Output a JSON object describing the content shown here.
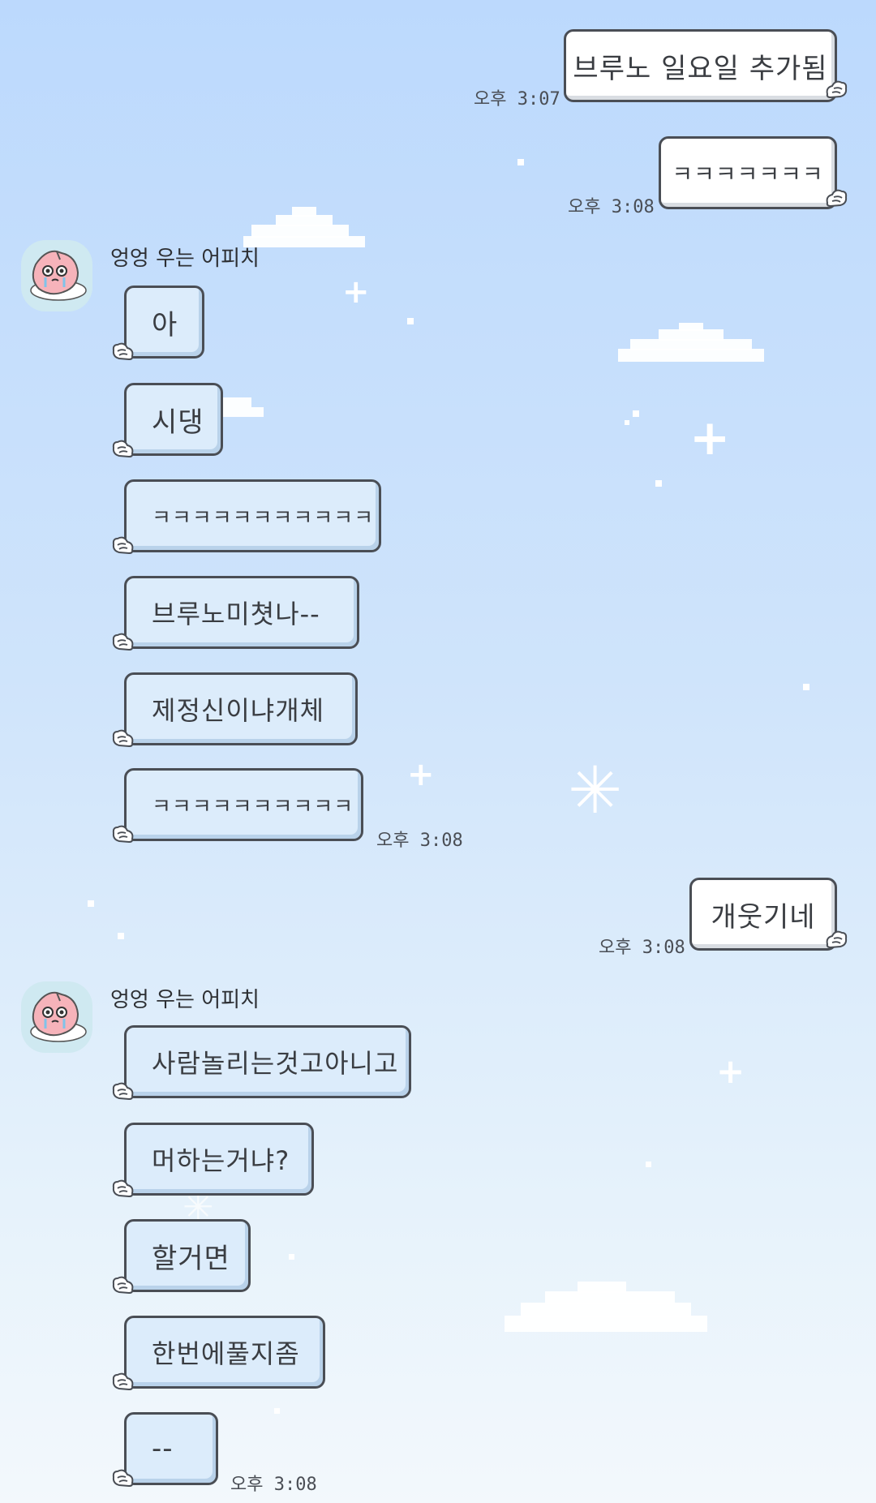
{
  "messages": [
    {
      "dir": "out",
      "text": "브루노 일요일 추가됨",
      "time": "오후 3:07"
    },
    {
      "dir": "out",
      "text": "ㅋㅋㅋㅋㅋㅋㅋ",
      "time": "오후 3:08"
    },
    {
      "dir": "in",
      "sender": "엉엉 우는 어피치",
      "texts": [
        "아",
        "시댕",
        "ㅋㅋㅋㅋㅋㅋㅋㅋㅋㅋㅋ",
        "브루노미쳣나--",
        "제정신이냐개체",
        "ㅋㅋㅋㅋㅋㅋㅋㅋㅋㅋ"
      ],
      "time": "오후 3:08"
    },
    {
      "dir": "out",
      "text": "개웃기네",
      "time": "오후 3:08"
    },
    {
      "dir": "in",
      "sender": "엉엉 우는 어피치",
      "texts": [
        "사람놀리는것고아니고",
        "머하는거냐?",
        "할거면",
        "한번에풀지좀",
        "--"
      ],
      "time": "오후 3:08"
    }
  ],
  "theme": {
    "incoming_bubble": "#dcecfb",
    "outgoing_bubble": "#ffffff",
    "border": "#4a4e55"
  },
  "icons": {
    "avatar": "apeach-crying-avatar-icon",
    "tail": "angel-wing-icon"
  }
}
